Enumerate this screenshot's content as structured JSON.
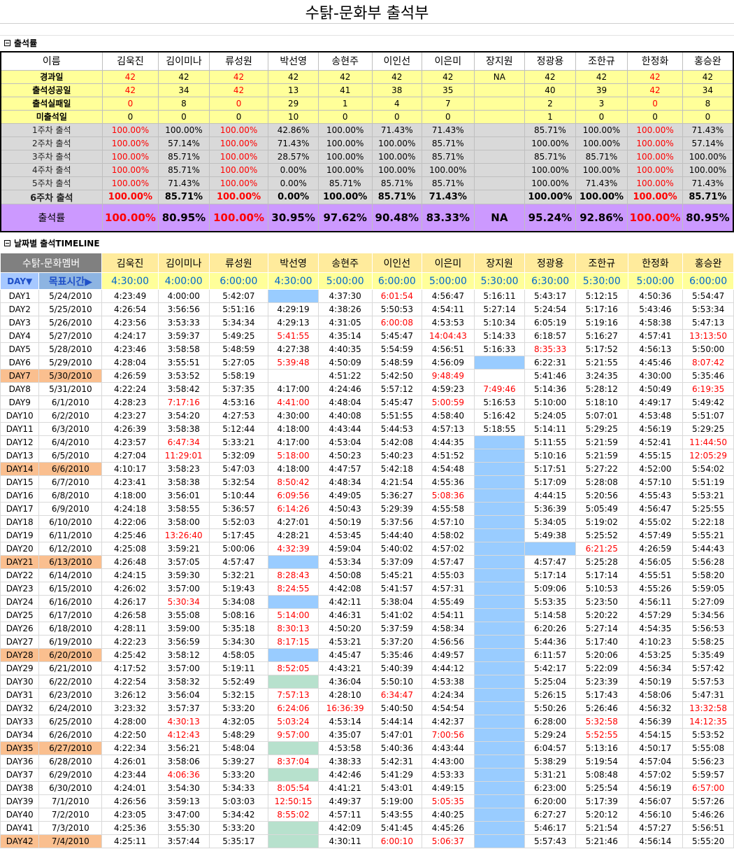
{
  "title": "수탉-문화부 출석부",
  "section1": "출석률",
  "section2": "날짜별 출석TIMELINE",
  "name_header": "이름",
  "members": [
    "김욱진",
    "김이미나",
    "류성원",
    "박선영",
    "송현주",
    "이인선",
    "이은미",
    "장지원",
    "정광용",
    "조한규",
    "한정화",
    "홍승완"
  ],
  "stats": [
    {
      "label": "경과일",
      "values": [
        "42",
        "42",
        "42",
        "42",
        "42",
        "42",
        "42",
        "NA",
        "42",
        "42",
        "42",
        "42"
      ]
    },
    {
      "label": "출석성공일",
      "values": [
        "42",
        "34",
        "42",
        "13",
        "41",
        "38",
        "35",
        "",
        "40",
        "39",
        "42",
        "34"
      ]
    },
    {
      "label": "출석실패일",
      "values": [
        "0",
        "8",
        "0",
        "29",
        "1",
        "4",
        "7",
        "",
        "2",
        "3",
        "0",
        "8"
      ]
    },
    {
      "label": "미출석일",
      "values": [
        "0",
        "0",
        "0",
        "10",
        "0",
        "0",
        "0",
        "",
        "1",
        "0",
        "0",
        "0"
      ]
    }
  ],
  "weeks": [
    {
      "label": "1주차 출석",
      "values": [
        "100.00%",
        "100.00%",
        "100.00%",
        "42.86%",
        "100.00%",
        "71.43%",
        "71.43%",
        "",
        "85.71%",
        "100.00%",
        "100.00%",
        "71.43%"
      ]
    },
    {
      "label": "2주차 출석",
      "values": [
        "100.00%",
        "57.14%",
        "100.00%",
        "71.43%",
        "100.00%",
        "100.00%",
        "85.71%",
        "",
        "100.00%",
        "100.00%",
        "100.00%",
        "57.14%"
      ]
    },
    {
      "label": "3주차 출석",
      "values": [
        "100.00%",
        "85.71%",
        "100.00%",
        "28.57%",
        "100.00%",
        "100.00%",
        "85.71%",
        "",
        "85.71%",
        "85.71%",
        "100.00%",
        "100.00%"
      ]
    },
    {
      "label": "4주차 출석",
      "values": [
        "100.00%",
        "85.71%",
        "100.00%",
        "0.00%",
        "100.00%",
        "100.00%",
        "100.00%",
        "",
        "100.00%",
        "100.00%",
        "100.00%",
        "100.00%"
      ]
    },
    {
      "label": "5주차 출석",
      "values": [
        "100.00%",
        "71.43%",
        "100.00%",
        "0.00%",
        "85.71%",
        "85.71%",
        "85.71%",
        "",
        "100.00%",
        "71.43%",
        "100.00%",
        "71.43%"
      ]
    },
    {
      "label": "6주차 출석",
      "values": [
        "100.00%",
        "85.71%",
        "100.00%",
        "0.00%",
        "100.00%",
        "85.71%",
        "71.43%",
        "",
        "100.00%",
        "100.00%",
        "100.00%",
        "85.71%"
      ]
    }
  ],
  "rate": {
    "label": "출석률",
    "values": [
      "100.00%",
      "80.95%",
      "100.00%",
      "30.95%",
      "97.62%",
      "90.48%",
      "83.33%",
      "NA",
      "95.24%",
      "92.86%",
      "100.00%",
      "80.95%"
    ]
  },
  "timeline_header": "수탉-문화멤버",
  "day_header": "DAY▼",
  "target_label": "목표시간▶",
  "targets": [
    "4:30:00",
    "4:00:00",
    "6:00:00",
    "4:30:00",
    "5:00:00",
    "6:00:00",
    "5:00:00",
    "5:30:00",
    "6:30:00",
    "5:30:00",
    "5:00:00",
    "6:00:00"
  ],
  "days": [
    {
      "day": "DAY1",
      "date": "5/24/2010",
      "t": [
        "4:23:49",
        "4:00:00",
        "5:42:07",
        "#B",
        "4:37:30",
        "!6:01:54",
        "4:56:47",
        "5:16:11",
        "5:43:17",
        "5:12:15",
        "4:50:36",
        "5:54:47"
      ]
    },
    {
      "day": "DAY2",
      "date": "5/25/2010",
      "t": [
        "4:26:54",
        "3:56:56",
        "5:51:16",
        "4:29:19",
        "4:38:26",
        "5:50:53",
        "4:54:11",
        "5:27:14",
        "5:24:54",
        "5:17:16",
        "5:43:46",
        "5:53:34"
      ]
    },
    {
      "day": "DAY3",
      "date": "5/26/2010",
      "t": [
        "4:23:56",
        "3:53:33",
        "5:34:34",
        "4:29:13",
        "4:31:05",
        "!6:00:08",
        "4:53:53",
        "5:10:34",
        "6:05:19",
        "5:19:16",
        "4:58:38",
        "5:47:13"
      ]
    },
    {
      "day": "DAY4",
      "date": "5/27/2010",
      "t": [
        "4:24:17",
        "3:59:37",
        "5:49:25",
        "!5:41:55",
        "4:35:14",
        "5:45:47",
        "!14:04:43",
        "5:14:33",
        "6:18:57",
        "5:16:27",
        "4:57:41",
        "!13:13:50"
      ]
    },
    {
      "day": "DAY5",
      "date": "5/28/2010",
      "t": [
        "4:23:46",
        "3:58:58",
        "5:48:59",
        "4:27:38",
        "4:40:35",
        "5:54:59",
        "4:56:51",
        "5:16:33",
        "!8:35:33",
        "5:17:52",
        "4:56:13",
        "5:50:00"
      ]
    },
    {
      "day": "DAY6",
      "date": "5/29/2010",
      "t": [
        "4:28:04",
        "3:55:51",
        "5:27:05",
        "!5:39:48",
        "4:50:09",
        "5:48:59",
        "4:56:09",
        "#B",
        "6:22:31",
        "5:21:55",
        "4:45:46",
        "!8:07:42"
      ]
    },
    {
      "day": "DAY7",
      "date": "5/30/2010",
      "w": true,
      "t": [
        "4:26:59",
        "3:53:52",
        "5:58:19",
        "",
        "4:51:22",
        "5:42:50",
        "!9:48:49",
        "",
        "5:41:46",
        "3:24:35",
        "4:30:00",
        "5:35:46"
      ]
    },
    {
      "day": "DAY8",
      "date": "5/31/2010",
      "t": [
        "4:22:24",
        "3:58:42",
        "5:37:35",
        "4:17:00",
        "4:24:46",
        "5:57:12",
        "4:59:23",
        "!7:49:46",
        "5:14:36",
        "5:28:12",
        "4:50:49",
        "!6:19:35"
      ]
    },
    {
      "day": "DAY9",
      "date": "6/1/2010",
      "t": [
        "4:28:23",
        "!7:17:16",
        "4:53:16",
        "!4:41:00",
        "4:48:04",
        "5:45:47",
        "!5:00:59",
        "5:16:53",
        "5:10:00",
        "5:18:10",
        "4:49:17",
        "5:49:42"
      ]
    },
    {
      "day": "DAY10",
      "date": "6/2/2010",
      "t": [
        "4:23:27",
        "3:54:20",
        "4:27:53",
        "4:30:00",
        "4:40:08",
        "5:51:55",
        "4:58:40",
        "5:16:42",
        "5:24:05",
        "5:07:01",
        "4:53:48",
        "5:51:07"
      ]
    },
    {
      "day": "DAY11",
      "date": "6/3/2010",
      "t": [
        "4:26:39",
        "3:58:38",
        "5:12:44",
        "4:18:00",
        "4:43:44",
        "5:44:53",
        "4:57:13",
        "5:18:55",
        "5:14:11",
        "5:29:25",
        "4:56:19",
        "5:29:25"
      ]
    },
    {
      "day": "DAY12",
      "date": "6/4/2010",
      "t": [
        "4:23:57",
        "!6:47:34",
        "5:33:21",
        "4:17:00",
        "4:53:04",
        "5:42:08",
        "4:44:35",
        "#B",
        "5:11:55",
        "5:21:59",
        "4:52:41",
        "!11:44:50"
      ]
    },
    {
      "day": "DAY13",
      "date": "6/5/2010",
      "t": [
        "4:27:04",
        "!11:29:01",
        "5:32:09",
        "!5:18:00",
        "4:50:23",
        "5:40:23",
        "4:51:52",
        "#B",
        "5:10:16",
        "5:21:59",
        "4:55:15",
        "!12:05:29"
      ]
    },
    {
      "day": "DAY14",
      "date": "6/6/2010",
      "w": true,
      "t": [
        "4:10:17",
        "3:58:23",
        "5:47:03",
        "4:18:00",
        "4:47:57",
        "5:42:18",
        "4:54:48",
        "#B",
        "5:17:51",
        "5:27:22",
        "4:52:00",
        "5:54:02"
      ]
    },
    {
      "day": "DAY15",
      "date": "6/7/2010",
      "t": [
        "4:23:41",
        "3:58:38",
        "5:32:54",
        "!8:50:42",
        "4:48:34",
        "4:21:54",
        "4:55:36",
        "#B",
        "5:17:09",
        "5:28:08",
        "4:57:10",
        "5:51:19"
      ]
    },
    {
      "day": "DAY16",
      "date": "6/8/2010",
      "t": [
        "4:18:00",
        "3:56:01",
        "5:10:44",
        "!6:09:56",
        "4:49:05",
        "5:36:27",
        "!5:08:36",
        "#B",
        "4:44:15",
        "5:20:56",
        "4:55:43",
        "5:53:21"
      ]
    },
    {
      "day": "DAY17",
      "date": "6/9/2010",
      "t": [
        "4:24:18",
        "3:58:55",
        "5:36:57",
        "!6:14:26",
        "4:50:43",
        "5:29:39",
        "4:55:58",
        "#B",
        "5:36:39",
        "5:05:49",
        "4:56:47",
        "5:25:55"
      ]
    },
    {
      "day": "DAY18",
      "date": "6/10/2010",
      "t": [
        "4:22:06",
        "3:58:00",
        "5:52:03",
        "4:27:01",
        "4:50:19",
        "5:37:56",
        "4:57:10",
        "#B",
        "5:34:05",
        "5:19:02",
        "4:55:02",
        "5:22:18"
      ]
    },
    {
      "day": "DAY19",
      "date": "6/11/2010",
      "t": [
        "4:25:46",
        "!13:26:40",
        "5:17:45",
        "4:28:21",
        "4:53:45",
        "5:44:40",
        "4:58:02",
        "#B",
        "5:49:38",
        "5:25:52",
        "4:57:49",
        "5:55:21"
      ]
    },
    {
      "day": "DAY20",
      "date": "6/12/2010",
      "t": [
        "4:25:08",
        "3:59:21",
        "5:00:06",
        "!4:32:39",
        "4:59:04",
        "5:40:02",
        "4:57:02",
        "#B",
        "#B",
        "!6:21:25",
        "4:26:59",
        "5:44:43"
      ]
    },
    {
      "day": "DAY21",
      "date": "6/13/2010",
      "w": true,
      "t": [
        "4:26:48",
        "3:57:05",
        "4:57:47",
        "#B",
        "4:53:34",
        "5:37:09",
        "4:57:47",
        "#B",
        "4:57:47",
        "5:25:28",
        "4:56:05",
        "5:56:28"
      ]
    },
    {
      "day": "DAY22",
      "date": "6/14/2010",
      "t": [
        "4:24:15",
        "3:59:30",
        "5:32:21",
        "!8:28:43",
        "4:50:08",
        "5:45:21",
        "4:55:03",
        "#B",
        "5:17:14",
        "5:17:14",
        "4:55:51",
        "5:58:20"
      ]
    },
    {
      "day": "DAY23",
      "date": "6/15/2010",
      "t": [
        "4:26:02",
        "3:57:00",
        "5:19:43",
        "!8:24:55",
        "4:42:08",
        "5:41:57",
        "4:57:31",
        "#B",
        "5:09:06",
        "5:10:53",
        "4:55:26",
        "5:59:05"
      ]
    },
    {
      "day": "DAY24",
      "date": "6/16/2010",
      "t": [
        "4:26:17",
        "!5:30:34",
        "5:34:08",
        "#B",
        "4:42:11",
        "5:38:04",
        "4:55:49",
        "#B",
        "5:53:35",
        "5:23:50",
        "4:56:11",
        "5:27:09"
      ]
    },
    {
      "day": "DAY25",
      "date": "6/17/2010",
      "t": [
        "4:26:58",
        "3:55:08",
        "5:08:16",
        "!5:14:00",
        "4:46:31",
        "5:41:02",
        "4:54:11",
        "#B",
        "5:14:58",
        "5:20:22",
        "4:57:29",
        "5:34:56"
      ]
    },
    {
      "day": "DAY26",
      "date": "6/18/2010",
      "t": [
        "4:28:11",
        "3:59:00",
        "5:35:18",
        "!8:30:13",
        "4:50:20",
        "5:37:59",
        "4:58:34",
        "#B",
        "6:20:26",
        "5:27:14",
        "4:54:35",
        "5:56:53"
      ]
    },
    {
      "day": "DAY27",
      "date": "6/19/2010",
      "t": [
        "4:22:23",
        "3:56:59",
        "5:34:30",
        "!8:17:15",
        "4:53:21",
        "5:37:20",
        "4:56:56",
        "#B",
        "5:44:36",
        "5:17:40",
        "4:10:23",
        "5:58:25"
      ]
    },
    {
      "day": "DAY28",
      "date": "6/20/2010",
      "w": true,
      "t": [
        "4:25:42",
        "3:58:12",
        "4:58:05",
        "#B",
        "4:45:47",
        "5:35:46",
        "4:49:57",
        "#B",
        "6:11:57",
        "5:20:06",
        "4:53:25",
        "5:35:49"
      ]
    },
    {
      "day": "DAY29",
      "date": "6/21/2010",
      "t": [
        "4:17:52",
        "3:57:00",
        "5:19:11",
        "!8:52:05",
        "4:43:21",
        "5:40:39",
        "4:44:12",
        "#B",
        "5:42:17",
        "5:22:09",
        "4:56:34",
        "5:57:42"
      ]
    },
    {
      "day": "DAY30",
      "date": "6/22/2010",
      "t": [
        "4:22:54",
        "3:58:32",
        "5:52:49",
        "#M",
        "4:36:04",
        "5:50:10",
        "4:53:38",
        "#B",
        "5:25:04",
        "5:23:39",
        "4:50:19",
        "5:57:53"
      ]
    },
    {
      "day": "DAY31",
      "date": "6/23/2010",
      "t": [
        "3:26:12",
        "3:56:04",
        "5:32:15",
        "!7:57:13",
        "4:28:10",
        "!6:34:47",
        "4:24:34",
        "#B",
        "5:26:15",
        "5:17:43",
        "4:58:06",
        "5:47:31"
      ]
    },
    {
      "day": "DAY32",
      "date": "6/24/2010",
      "t": [
        "3:23:32",
        "3:57:37",
        "5:33:20",
        "!6:24:06",
        "!16:36:39",
        "5:40:50",
        "4:54:54",
        "#B",
        "5:50:26",
        "5:26:46",
        "4:56:32",
        "!13:32:58"
      ]
    },
    {
      "day": "DAY33",
      "date": "6/25/2010",
      "t": [
        "4:28:00",
        "!4:30:13",
        "4:32:05",
        "!5:03:24",
        "4:53:14",
        "5:44:14",
        "4:42:37",
        "#B",
        "6:28:00",
        "!5:32:58",
        "4:56:39",
        "!14:12:35"
      ]
    },
    {
      "day": "DAY34",
      "date": "6/26/2010",
      "t": [
        "4:22:50",
        "!4:12:43",
        "5:48:29",
        "!9:57:00",
        "4:35:07",
        "5:47:01",
        "!7:00:56",
        "#B",
        "5:29:24",
        "!5:52:55",
        "4:54:15",
        "5:53:52"
      ]
    },
    {
      "day": "DAY35",
      "date": "6/27/2010",
      "w": true,
      "t": [
        "4:22:34",
        "3:56:21",
        "5:48:04",
        "#M",
        "4:53:58",
        "5:40:36",
        "4:43:44",
        "#B",
        "6:04:57",
        "5:13:16",
        "4:50:17",
        "5:55:08"
      ]
    },
    {
      "day": "DAY36",
      "date": "6/28/2010",
      "t": [
        "4:26:01",
        "3:58:06",
        "5:39:27",
        "!8:37:04",
        "4:38:33",
        "5:42:31",
        "4:43:00",
        "#B",
        "5:38:29",
        "5:19:54",
        "4:57:04",
        "5:56:23"
      ]
    },
    {
      "day": "DAY37",
      "date": "6/29/2010",
      "t": [
        "4:23:44",
        "!4:06:36",
        "5:33:20",
        "#M",
        "4:42:46",
        "5:41:29",
        "4:53:33",
        "#B",
        "5:31:21",
        "5:08:48",
        "4:57:02",
        "5:59:57"
      ]
    },
    {
      "day": "DAY38",
      "date": "6/30/2010",
      "t": [
        "4:24:01",
        "3:54:30",
        "5:34:33",
        "!8:05:54",
        "4:41:21",
        "5:43:01",
        "4:49:15",
        "#B",
        "6:23:00",
        "5:25:54",
        "4:56:19",
        "!6:57:00"
      ]
    },
    {
      "day": "DAY39",
      "date": "7/1/2010",
      "t": [
        "4:26:56",
        "3:59:13",
        "5:03:03",
        "!12:50:15",
        "4:49:37",
        "5:19:00",
        "!5:05:35",
        "#B",
        "6:20:00",
        "5:17:39",
        "4:56:07",
        "5:57:26"
      ]
    },
    {
      "day": "DAY40",
      "date": "7/2/2010",
      "t": [
        "4:23:05",
        "3:47:00",
        "5:34:42",
        "!8:55:02",
        "4:57:11",
        "5:43:55",
        "4:40:25",
        "#B",
        "6:27:27",
        "5:20:12",
        "4:56:10",
        "5:46:26"
      ]
    },
    {
      "day": "DAY41",
      "date": "7/3/2010",
      "t": [
        "4:25:36",
        "3:55:30",
        "5:33:20",
        "#M",
        "4:42:09",
        "5:41:45",
        "4:45:26",
        "#B",
        "5:46:17",
        "5:21:54",
        "4:57:27",
        "5:56:51"
      ]
    },
    {
      "day": "DAY42",
      "date": "7/4/2010",
      "w": true,
      "t": [
        "4:25:11",
        "3:57:44",
        "5:35:17",
        "#M",
        "4:30:11",
        "!6:00:10",
        "!5:06:37",
        "#B",
        "5:57:43",
        "5:21:46",
        "4:56:14",
        "5:55:20"
      ]
    }
  ],
  "colors": {
    "highlight_red": "#ff0000",
    "weekend": "#fabf8f",
    "absent_blue": "#99ccff",
    "absent_mint": "#b7e1cd",
    "rate_purple": "#cc99ff",
    "stat_yellow": "#ffff99"
  }
}
